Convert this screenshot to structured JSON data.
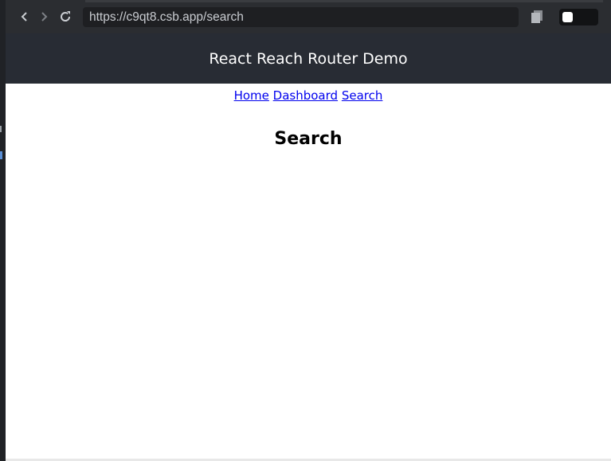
{
  "browser": {
    "url": "https://c9qt8.csb.app/search",
    "icons": [
      "back-icon",
      "forward-icon",
      "reload-icon",
      "copy-icon"
    ],
    "toggle_color": "#ffffff"
  },
  "app": {
    "header_title": "React Reach Router Demo",
    "header_bg": "#282c34"
  },
  "nav": {
    "links": [
      {
        "label": "Home"
      },
      {
        "label": "Dashboard"
      },
      {
        "label": "Search"
      }
    ]
  },
  "page": {
    "heading": "Search"
  }
}
